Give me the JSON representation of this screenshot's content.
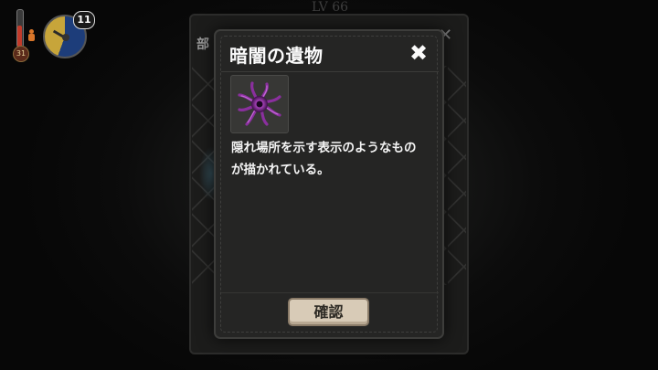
{
  "hud": {
    "temperature_value": "31",
    "badge_value": "11",
    "colors": {
      "thermo_fill": "#c23a2a",
      "gauge_night": "#1d3d7a",
      "gauge_day": "#c7a53a"
    }
  },
  "background_panel": {
    "title": "LV 66",
    "label": "部",
    "close_icon": "close-icon"
  },
  "modal": {
    "title": "暗闇の遺物",
    "close_symbol": "✖",
    "item_icon": "dark-relic-icon",
    "description_lines": [
      "隠れ場所を示す表示のようなもの",
      "が描かれている。"
    ],
    "confirm_label": "確認",
    "colors": {
      "panel_bg": "#252524",
      "title_text": "#fbfbfb",
      "button_bg": "#d8cbb7",
      "relic_purple": "#b247c6"
    }
  }
}
